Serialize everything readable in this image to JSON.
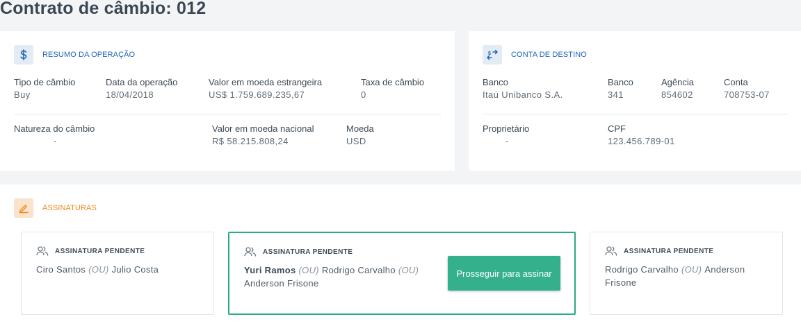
{
  "page_title": "Contrato de câmbio: 012",
  "operation": {
    "title": "RESUMO DA OPERAÇÃO",
    "icon": "dollar-icon",
    "tipo_label": "Tipo de câmbio",
    "tipo_value": "Buy",
    "data_label": "Data da operação",
    "data_value": "18/04/2018",
    "estrangeira_label": "Valor em moeda estrangeira",
    "estrangeira_value": "US$ 1.759.689.235,67",
    "taxa_label": "Taxa de câmbio",
    "taxa_value": "0",
    "natureza_label": "Natureza do câmbio",
    "natureza_value": "-",
    "nacional_label": "Valor em moeda nacional",
    "nacional_value": "R$ 58.215.808,24",
    "moeda_label": "Moeda",
    "moeda_value": "USD"
  },
  "destination": {
    "title": "CONTA DE DESTINO",
    "icon": "transfer-icon",
    "banco_name_label": "Banco",
    "banco_name_value": "Itaú Unibanco S.A.",
    "banco_code_label": "Banco",
    "banco_code_value": "341",
    "agencia_label": "Agência",
    "agencia_value": "854602",
    "conta_label": "Conta",
    "conta_value": "708753-07",
    "proprietario_label": "Proprietário",
    "proprietario_value": "-",
    "cpf_label": "CPF",
    "cpf_value": "123.456.789-01"
  },
  "signatures": {
    "title": "ASSINATURAS",
    "icon": "pen-icon",
    "or_label": "(OU)",
    "boxes": [
      {
        "status": "ASSINATURA PENDENTE",
        "names": [
          "Ciro Santos",
          "Julio Costa"
        ]
      },
      {
        "status": "ASSINATURA PENDENTE",
        "names": [
          "Yuri Ramos",
          "Rodrigo Carvalho",
          "Anderson Frisone"
        ],
        "button": "Prosseguir para assinar"
      },
      {
        "status": "ASSINATURA PENDENTE",
        "names": [
          "Rodrigo Carvalho",
          "Anderson Frisone"
        ]
      }
    ]
  },
  "colors": {
    "primary_blue": "#1d63b8",
    "accent_orange": "#f0891b",
    "success_green": "#35b08d"
  }
}
